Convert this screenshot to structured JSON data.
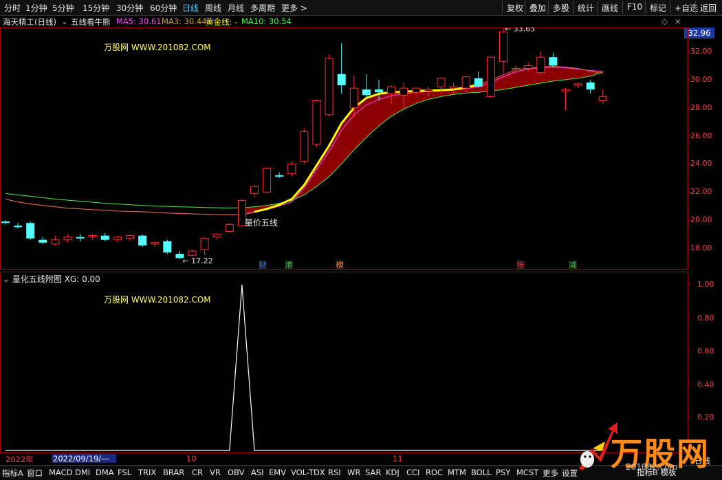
{
  "toolbar": {
    "periods": [
      "分时",
      "1分钟",
      "5分钟",
      "15分钟",
      "30分钟",
      "60分钟",
      "日线",
      "周线",
      "月线",
      "多周期",
      "更多 >"
    ],
    "active_period": "日线",
    "right_buttons": [
      "复权",
      "叠加",
      "多股",
      "统计",
      "画线",
      "F10",
      "标记",
      "+自选",
      "返回"
    ]
  },
  "info_bar": {
    "stock": "海天精工(日线)",
    "indicator": "五线看牛熊",
    "ma5_label": "MA5: 30.61",
    "ma3_label": "MA3: 30.44",
    "gold_label": "黄金线: -",
    "ma10_label": "MA10: 30.54",
    "current_price": "32.96",
    "ma5_color": "#ff44ff",
    "ma3_color": "#d0a040",
    "gold_color": "#ffff00",
    "ma10_color": "#44ff44"
  },
  "watermark": "万股网 WWW.201082.COM",
  "sub_panel": {
    "title": "量化五线附图 XG: 0.00",
    "y_ticks": [
      "1.00",
      "0.80",
      "0.60",
      "0.40",
      "0.20"
    ]
  },
  "date_bar": {
    "year": "2022年",
    "cursor_date": "2022/09/19/—",
    "months": [
      "10",
      "11"
    ],
    "right_label": "日线"
  },
  "bottom_tabs": [
    "指标A",
    "窗口",
    "MACD",
    "DMI",
    "DMA",
    "FSL",
    "TRIX",
    "BRAR",
    "CR",
    "VR",
    "OBV",
    "ASI",
    "EMV",
    "VOL-TDX",
    "RSI",
    "WR",
    "SAR",
    "KDJ",
    "CCI",
    "ROC",
    "MTM",
    "BOLL",
    "PSY",
    "MCST",
    "更多",
    "设置"
  ],
  "bottom_right": "指标B 模板",
  "logo": {
    "text": "万股网",
    "url": "201082.com"
  },
  "chart_data": [
    {
      "type": "candlestick",
      "title": "海天精工(日线)",
      "ylim": [
        16.5,
        34
      ],
      "y_ticks": [
        18,
        20,
        22,
        24,
        26,
        28,
        30,
        32
      ],
      "high_label": "33.65",
      "low_label": "17.22",
      "signal_label": "量价五线",
      "event_markers": [
        "财",
        "港",
        "榜",
        "张",
        "减"
      ],
      "candles": [
        {
          "o": 19.9,
          "h": 20.0,
          "l": 19.7,
          "c": 19.8
        },
        {
          "o": 19.6,
          "h": 19.8,
          "l": 19.4,
          "c": 19.5
        },
        {
          "o": 19.8,
          "h": 19.9,
          "l": 18.6,
          "c": 18.7
        },
        {
          "o": 18.6,
          "h": 18.8,
          "l": 18.3,
          "c": 18.4
        },
        {
          "o": 18.3,
          "h": 18.9,
          "l": 18.2,
          "c": 18.6
        },
        {
          "o": 18.6,
          "h": 19.0,
          "l": 18.4,
          "c": 18.8
        },
        {
          "o": 18.8,
          "h": 19.0,
          "l": 18.5,
          "c": 18.7
        },
        {
          "o": 18.8,
          "h": 19.0,
          "l": 18.6,
          "c": 18.9
        },
        {
          "o": 18.9,
          "h": 19.1,
          "l": 18.5,
          "c": 18.6
        },
        {
          "o": 18.6,
          "h": 18.9,
          "l": 18.4,
          "c": 18.8
        },
        {
          "o": 18.7,
          "h": 19.0,
          "l": 18.5,
          "c": 18.9
        },
        {
          "o": 18.9,
          "h": 19.0,
          "l": 18.1,
          "c": 18.2
        },
        {
          "o": 18.3,
          "h": 18.5,
          "l": 18.1,
          "c": 18.4
        },
        {
          "o": 18.5,
          "h": 18.6,
          "l": 17.6,
          "c": 17.7
        },
        {
          "o": 17.6,
          "h": 17.8,
          "l": 17.22,
          "c": 17.3
        },
        {
          "o": 17.5,
          "h": 17.9,
          "l": 17.4,
          "c": 17.8
        },
        {
          "o": 17.9,
          "h": 18.8,
          "l": 17.5,
          "c": 18.7
        },
        {
          "o": 18.8,
          "h": 19.1,
          "l": 18.6,
          "c": 19.0
        },
        {
          "o": 19.2,
          "h": 19.8,
          "l": 19.1,
          "c": 19.7
        },
        {
          "o": 19.6,
          "h": 21.5,
          "l": 19.5,
          "c": 21.4
        },
        {
          "o": 21.9,
          "h": 22.5,
          "l": 21.6,
          "c": 22.4
        },
        {
          "o": 22.0,
          "h": 23.8,
          "l": 21.9,
          "c": 23.7
        },
        {
          "o": 23.2,
          "h": 23.4,
          "l": 23.0,
          "c": 23.1
        },
        {
          "o": 23.3,
          "h": 24.2,
          "l": 23.1,
          "c": 24.0
        },
        {
          "o": 24.2,
          "h": 26.5,
          "l": 24.0,
          "c": 26.3
        },
        {
          "o": 25.4,
          "h": 28.6,
          "l": 25.2,
          "c": 28.5
        },
        {
          "o": 27.5,
          "h": 31.8,
          "l": 27.4,
          "c": 31.5
        },
        {
          "o": 30.4,
          "h": 32.6,
          "l": 29.0,
          "c": 29.6
        },
        {
          "o": 28.0,
          "h": 30.3,
          "l": 27.3,
          "c": 29.4
        },
        {
          "o": 29.3,
          "h": 30.4,
          "l": 28.7,
          "c": 28.9
        },
        {
          "o": 29.3,
          "h": 30.0,
          "l": 28.5,
          "c": 29.1
        },
        {
          "o": 29.0,
          "h": 29.6,
          "l": 28.3,
          "c": 29.5
        },
        {
          "o": 28.9,
          "h": 29.8,
          "l": 27.8,
          "c": 29.4
        },
        {
          "o": 29.1,
          "h": 29.4,
          "l": 28.9,
          "c": 29.4
        },
        {
          "o": 29.2,
          "h": 29.5,
          "l": 28.8,
          "c": 29.3
        },
        {
          "o": 29.5,
          "h": 30.2,
          "l": 29.0,
          "c": 30.1
        },
        {
          "o": 29.4,
          "h": 29.8,
          "l": 29.0,
          "c": 29.5
        },
        {
          "o": 29.4,
          "h": 30.3,
          "l": 29.1,
          "c": 30.2
        },
        {
          "o": 30.1,
          "h": 30.6,
          "l": 29.4,
          "c": 29.5
        },
        {
          "o": 28.8,
          "h": 31.6,
          "l": 28.7,
          "c": 31.6
        },
        {
          "o": 31.3,
          "h": 33.65,
          "l": 30.4,
          "c": 33.4
        },
        {
          "o": 30.7,
          "h": 31.0,
          "l": 30.5,
          "c": 30.8
        },
        {
          "o": 30.8,
          "h": 31.2,
          "l": 30.6,
          "c": 31.0
        },
        {
          "o": 30.5,
          "h": 32.0,
          "l": 30.4,
          "c": 31.6
        },
        {
          "o": 31.6,
          "h": 31.9,
          "l": 30.9,
          "c": 31.0
        },
        {
          "o": 29.2,
          "h": 29.4,
          "l": 27.8,
          "c": 29.3
        },
        {
          "o": 29.6,
          "h": 29.8,
          "l": 29.4,
          "c": 29.7
        },
        {
          "o": 29.8,
          "h": 30.0,
          "l": 29.0,
          "c": 29.3
        },
        {
          "o": 28.5,
          "h": 29.3,
          "l": 28.3,
          "c": 28.8
        }
      ],
      "ma5": [
        21.5,
        21.3,
        21.15,
        21.05,
        20.95,
        20.85,
        20.8,
        20.75,
        20.7,
        20.65,
        20.62,
        20.6,
        20.55,
        20.5,
        20.48,
        20.45,
        20.42,
        20.4,
        20.38,
        20.4,
        20.55,
        20.75,
        21.0,
        21.3,
        22.3,
        23.6,
        24.9,
        26.4,
        27.5,
        28.2,
        28.6,
        28.85,
        29.0,
        29.1,
        29.15,
        29.2,
        29.25,
        29.35,
        29.5,
        29.8,
        30.2,
        30.55,
        30.75,
        30.85,
        30.9,
        30.85,
        30.75,
        30.65,
        30.6
      ],
      "ma3": [
        21.5,
        21.3,
        21.15,
        21.05,
        20.95,
        20.85,
        20.8,
        20.75,
        20.7,
        20.65,
        20.62,
        20.6,
        20.55,
        20.5,
        20.48,
        20.45,
        20.42,
        20.4,
        20.38,
        20.42,
        20.6,
        20.8,
        21.1,
        21.5,
        22.5,
        23.9,
        25.3,
        26.9,
        28.0,
        28.7,
        29.0,
        29.1,
        29.15,
        29.2,
        29.22,
        29.25,
        29.3,
        29.45,
        29.65,
        29.95,
        30.35,
        30.7,
        30.85,
        30.9,
        30.95,
        30.9,
        30.8,
        30.6,
        30.44
      ],
      "ma10": [
        21.9,
        21.8,
        21.7,
        21.6,
        21.5,
        21.42,
        21.35,
        21.28,
        21.2,
        21.15,
        21.1,
        21.05,
        21.0,
        20.98,
        20.95,
        20.93,
        20.9,
        20.88,
        20.87,
        20.88,
        20.95,
        21.05,
        21.2,
        21.4,
        21.8,
        22.4,
        23.1,
        24.0,
        25.0,
        25.9,
        26.7,
        27.4,
        27.9,
        28.3,
        28.6,
        28.8,
        28.95,
        29.05,
        29.1,
        29.2,
        29.3,
        29.45,
        29.6,
        29.75,
        29.9,
        30.0,
        30.1,
        30.25,
        30.54
      ],
      "gold_line_end_index": 38
    },
    {
      "type": "line",
      "title": "量化五线附图",
      "ylim": [
        0,
        1.05
      ],
      "values_description_text": "",
      "signal": {
        "spike_index": 19,
        "value": 1.0
      }
    }
  ]
}
